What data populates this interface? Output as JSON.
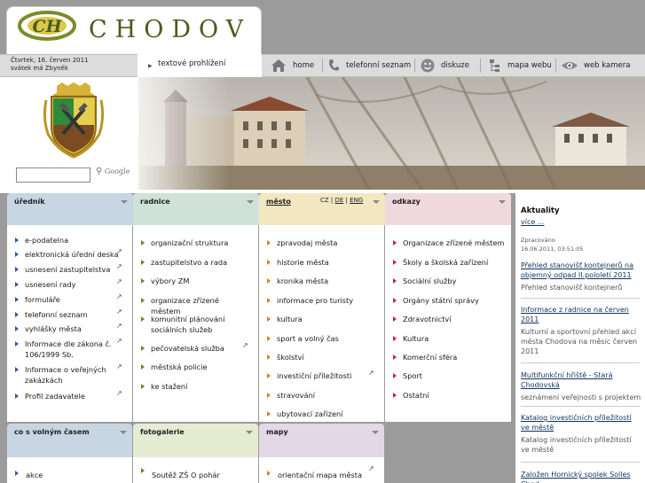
{
  "header": {
    "logo_text": "CHODOV",
    "date_line1": "Čtvrtek, 16. červen 2011",
    "date_line2": "svátek má Zbyněk",
    "text_view": "textové prohlížení"
  },
  "nav": {
    "home": "home",
    "phones": "telefonní seznam",
    "discussion": "diskuze",
    "sitemap": "mapa webu",
    "webcam": "web kamera"
  },
  "search": {
    "placeholder": "",
    "google": "Google"
  },
  "columns": {
    "urednik": {
      "title": "úředník",
      "color": "#c8d6e4",
      "items": [
        "e-podatelna",
        "elektronická úřední deska",
        "usnesení zastupitelstva",
        "usnesení rady",
        "formuláře",
        "telefonní seznam",
        "vyhlášky města",
        "Informace dle zákona č. 106/1999 Sb.",
        "Informace o veřejných zakázkách",
        "Profil zadavatele"
      ]
    },
    "radnice": {
      "title": "radnice",
      "color": "#cfe1d8",
      "items": [
        "organizační struktura",
        "zastupitelstvo a rada",
        "výbory ZM",
        "organizace zřízené městem",
        "komunitní plánování sociálních služeb",
        "pečovatelská služba",
        "městská policie",
        "ke stažení"
      ]
    },
    "mesto": {
      "title": "město",
      "color": "#f3e7c2",
      "lang_cz": "CZ",
      "lang_de": "DE",
      "lang_en": "ENG",
      "items": [
        "zpravodaj města",
        "historie města",
        "kronika města",
        "informace pro turisty",
        "kultura",
        "sport a volný čas",
        "školství",
        "investiční příležitosti",
        "stravování",
        "ubytovací zařízení"
      ]
    },
    "odkazy": {
      "title": "odkazy",
      "color": "#f0d9dc",
      "items": [
        "Organizace zřízené městem",
        "Školy a školská zařízení",
        "Sociální služby",
        "Orgány státní správy",
        "Zdravotnictví",
        "Kultura",
        "Komerční sféra",
        "Sport",
        "Ostatní"
      ]
    }
  },
  "row2": {
    "volny": {
      "title": "co s volným časem",
      "color": "#c8d6e4",
      "item": "akce"
    },
    "foto": {
      "title": "fotogalerie",
      "color": "#e5ecd2",
      "item": "Soutěž ZŠ O pohár"
    },
    "mapy": {
      "title": "mapy",
      "color": "#e2d8e6",
      "item": "orientační mapa města"
    }
  },
  "aside": {
    "title": "Aktuality",
    "more": "více ...",
    "processed": "Zpracováno",
    "processed_date": "16.06.2011, 03:51:05",
    "news": [
      {
        "title": "Přehled stanovišť kontejnerů na objemný odpad II.pololetí 2011",
        "text": "Přehled stanovišť kontejnerů"
      },
      {
        "title": "Informace z radnice na červen 2011",
        "text": "Kulturní a sportovní přehled akcí města Chodova na měsíc červen 2011"
      },
      {
        "title": "Multifunkční hřiště - Stará Chodovská",
        "text": "seznámení veřejnosti s projektem"
      },
      {
        "title": "Katalog investičních příležitostí ve městě",
        "text": "Katalog investičních příležitostí ve městě"
      },
      {
        "title": "Založen Hornický spolek Solles Chod...",
        "text": ""
      }
    ]
  }
}
